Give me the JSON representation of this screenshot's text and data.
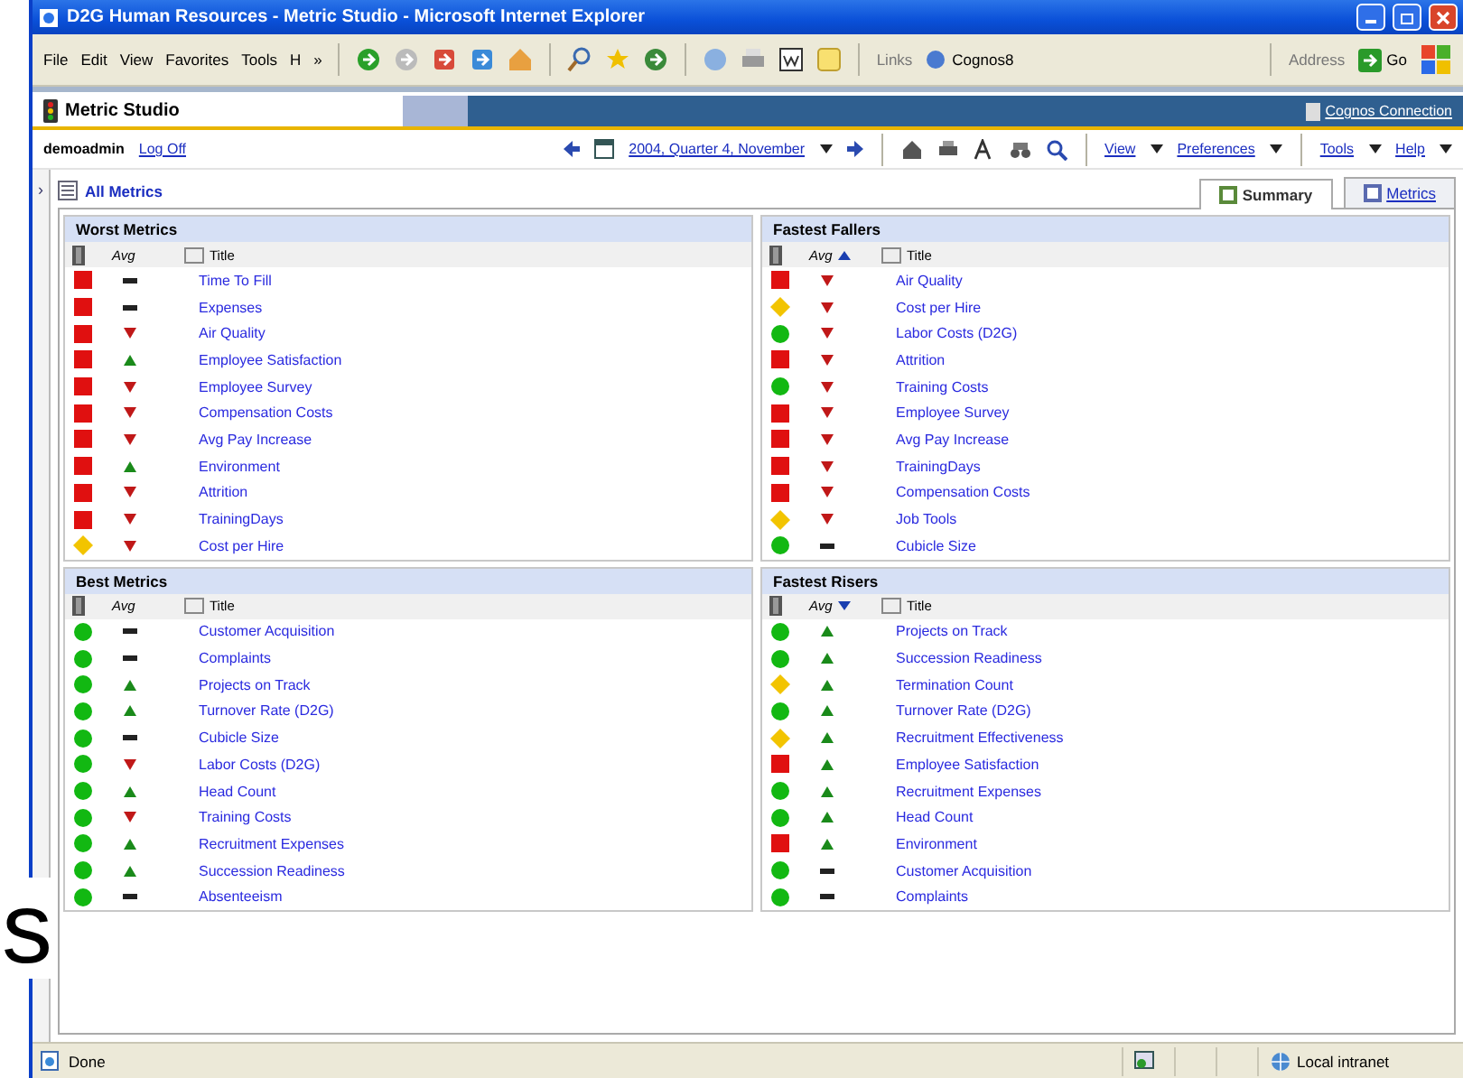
{
  "slide_fragment": "s",
  "window": {
    "title": "D2G Human Resources - Metric Studio - Microsoft Internet Explorer"
  },
  "menu": [
    "File",
    "Edit",
    "View",
    "Favorites",
    "Tools",
    "H"
  ],
  "menu_overflow": "»",
  "links": {
    "label": "Links",
    "item": "Cognos8"
  },
  "address": {
    "label": "Address",
    "go": "Go"
  },
  "app": {
    "name": "Metric Studio",
    "connection_link": "Cognos Connection"
  },
  "user_bar": {
    "user": "demoadmin",
    "logoff": "Log Off",
    "period": "2004, Quarter 4, November",
    "menus": [
      "View",
      "Preferences",
      "Tools",
      "Help"
    ]
  },
  "sidebar_toggle": "›",
  "breadcrumb": "All Metrics",
  "tabs": [
    {
      "label": "Summary",
      "selected": true
    },
    {
      "label": "Metrics",
      "selected": false
    }
  ],
  "panels": [
    {
      "title": "Worst Metrics",
      "columns": [
        "Avg",
        "Title"
      ],
      "sort_ascending": false,
      "sort_descending": false,
      "rows": [
        {
          "color": "#e01010",
          "kind": "flat",
          "title": "Time To Fill"
        },
        {
          "color": "#e01010",
          "kind": "flat",
          "title": "Expenses"
        },
        {
          "color": "#e01010",
          "kind": "down",
          "title": "Air Quality"
        },
        {
          "color": "#e01010",
          "kind": "up",
          "title": "Employee Satisfaction"
        },
        {
          "color": "#e01010",
          "kind": "down",
          "title": "Employee Survey"
        },
        {
          "color": "#e01010",
          "kind": "down",
          "title": "Compensation Costs"
        },
        {
          "color": "#e01010",
          "kind": "down",
          "title": "Avg Pay Increase"
        },
        {
          "color": "#e01010",
          "kind": "up",
          "title": "Environment"
        },
        {
          "color": "#e01010",
          "kind": "down",
          "title": "Attrition"
        },
        {
          "color": "#e01010",
          "kind": "down",
          "title": "TrainingDays"
        },
        {
          "color": "#f2c400",
          "kind": "down",
          "title": "Cost per Hire"
        }
      ]
    },
    {
      "title": "Fastest Fallers",
      "columns": [
        "Avg",
        "Title"
      ],
      "sort_ascending": true,
      "sort_descending": false,
      "rows": [
        {
          "color": "#e01010",
          "kind": "down",
          "title": "Air Quality"
        },
        {
          "color": "#f2c400",
          "kind": "down",
          "title": "Cost per Hire"
        },
        {
          "color": "#12b812",
          "kind": "down",
          "title": "Labor Costs (D2G)"
        },
        {
          "color": "#e01010",
          "kind": "down",
          "title": "Attrition"
        },
        {
          "color": "#12b812",
          "kind": "down",
          "title": "Training Costs"
        },
        {
          "color": "#e01010",
          "kind": "down",
          "title": "Employee Survey"
        },
        {
          "color": "#e01010",
          "kind": "down",
          "title": "Avg Pay Increase"
        },
        {
          "color": "#e01010",
          "kind": "down",
          "title": "TrainingDays"
        },
        {
          "color": "#e01010",
          "kind": "down",
          "title": "Compensation Costs"
        },
        {
          "color": "#f2c400",
          "kind": "down",
          "title": "Job Tools"
        },
        {
          "color": "#12b812",
          "kind": "flat",
          "title": "Cubicle Size"
        }
      ]
    },
    {
      "title": "Best Metrics",
      "columns": [
        "Avg",
        "Title"
      ],
      "sort_ascending": false,
      "sort_descending": false,
      "rows": [
        {
          "color": "#12b812",
          "kind": "flat",
          "title": "Customer Acquisition"
        },
        {
          "color": "#12b812",
          "kind": "flat",
          "title": "Complaints"
        },
        {
          "color": "#12b812",
          "kind": "up",
          "title": "Projects on Track"
        },
        {
          "color": "#12b812",
          "kind": "up",
          "title": "Turnover Rate (D2G)"
        },
        {
          "color": "#12b812",
          "kind": "flat",
          "title": "Cubicle Size"
        },
        {
          "color": "#12b812",
          "kind": "down",
          "title": "Labor Costs (D2G)"
        },
        {
          "color": "#12b812",
          "kind": "up",
          "title": "Head Count"
        },
        {
          "color": "#12b812",
          "kind": "down",
          "title": "Training Costs"
        },
        {
          "color": "#12b812",
          "kind": "up",
          "title": "Recruitment Expenses"
        },
        {
          "color": "#12b812",
          "kind": "up",
          "title": "Succession Readiness"
        },
        {
          "color": "#12b812",
          "kind": "flat",
          "title": "Absenteeism"
        }
      ]
    },
    {
      "title": "Fastest Risers",
      "columns": [
        "Avg",
        "Title"
      ],
      "sort_ascending": false,
      "sort_descending": true,
      "rows": [
        {
          "color": "#12b812",
          "kind": "up",
          "title": "Projects on Track"
        },
        {
          "color": "#12b812",
          "kind": "up",
          "title": "Succession Readiness"
        },
        {
          "color": "#f2c400",
          "kind": "up",
          "title": "Termination Count"
        },
        {
          "color": "#12b812",
          "kind": "up",
          "title": "Turnover Rate (D2G)"
        },
        {
          "color": "#f2c400",
          "kind": "up",
          "title": "Recruitment Effectiveness"
        },
        {
          "color": "#e01010",
          "kind": "up",
          "title": "Employee Satisfaction"
        },
        {
          "color": "#12b812",
          "kind": "up",
          "title": "Recruitment Expenses"
        },
        {
          "color": "#12b812",
          "kind": "up",
          "title": "Head Count"
        },
        {
          "color": "#e01010",
          "kind": "up",
          "title": "Environment"
        },
        {
          "color": "#12b812",
          "kind": "flat",
          "title": "Customer Acquisition"
        },
        {
          "color": "#12b812",
          "kind": "flat",
          "title": "Complaints"
        }
      ]
    }
  ],
  "status_bar": {
    "text": "Done",
    "zone": "Local intranet"
  }
}
